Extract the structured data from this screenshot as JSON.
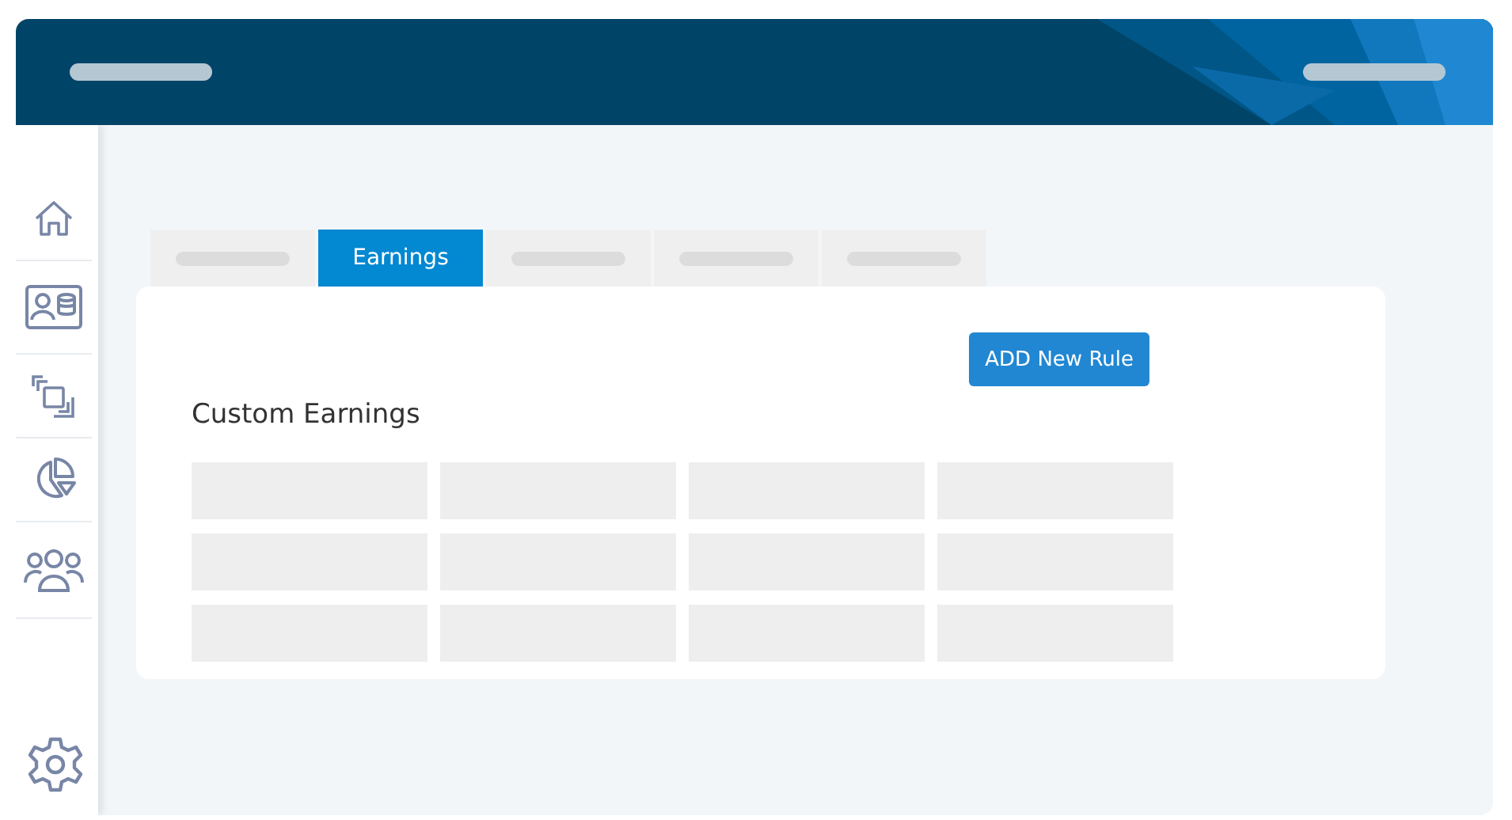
{
  "sidebar": {
    "items": [
      {
        "kind": "home"
      },
      {
        "kind": "id-card"
      },
      {
        "kind": "windows"
      },
      {
        "kind": "pie"
      },
      {
        "kind": "people"
      }
    ],
    "footer": {
      "kind": "settings"
    }
  },
  "tabs": [
    {
      "selected": false
    },
    {
      "label": "Earnings",
      "selected": true
    },
    {
      "selected": false
    },
    {
      "selected": false
    },
    {
      "selected": false
    }
  ],
  "card": {
    "title": "Custom Earnings",
    "button": "ADD New Rule"
  },
  "table": {
    "rows": [
      {
        "cells": [
          {
            "kind": "placeholder"
          },
          {
            "kind": "placeholder"
          },
          {
            "kind": "placeholder"
          },
          {
            "kind": "placeholder"
          }
        ]
      },
      {
        "cells": [
          {
            "kind": "placeholder"
          },
          {
            "kind": "placeholder"
          },
          {
            "kind": "placeholder"
          },
          {
            "kind": "placeholder"
          }
        ]
      },
      {
        "cells": [
          {
            "kind": "placeholder"
          },
          {
            "kind": "placeholder"
          },
          {
            "kind": "placeholder"
          },
          {
            "kind": "placeholder"
          }
        ]
      }
    ]
  }
}
